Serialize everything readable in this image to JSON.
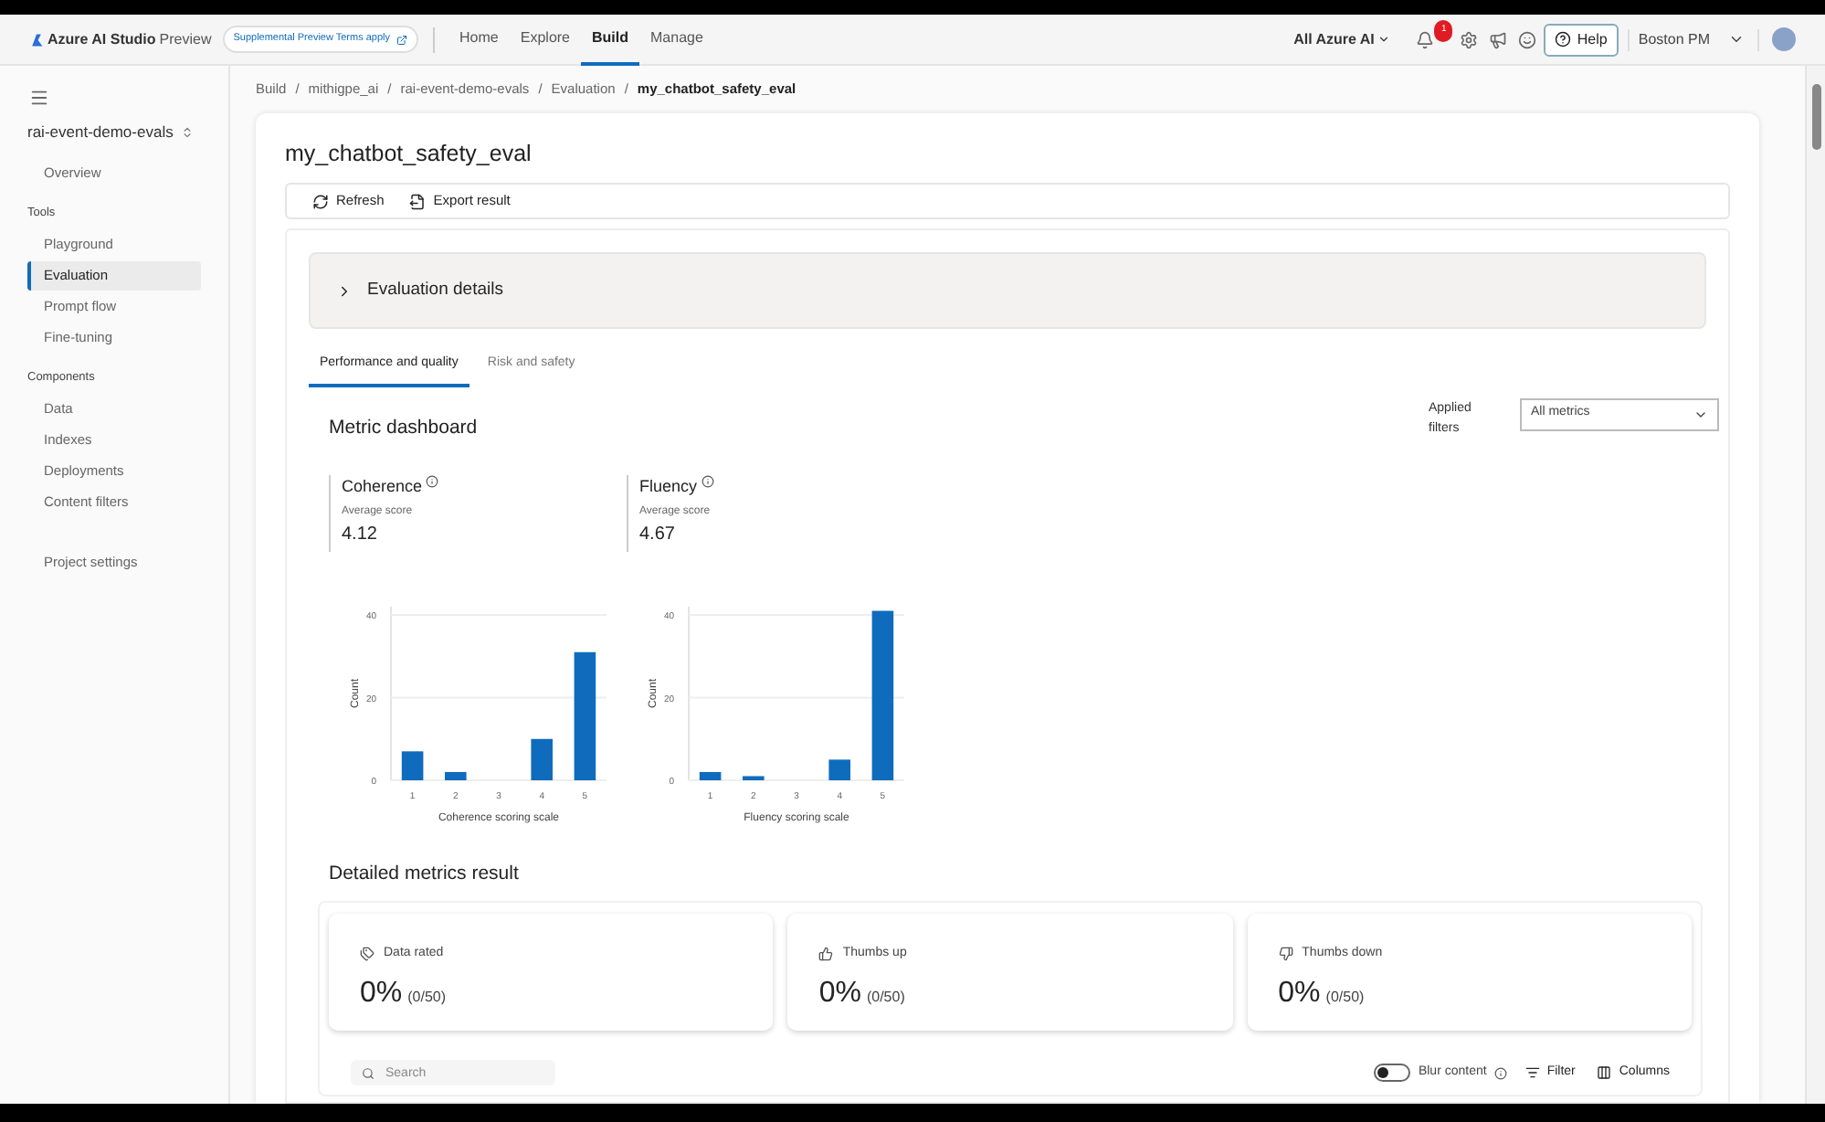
{
  "header": {
    "product": "Azure AI Studio",
    "preview": "Preview",
    "terms_badge": "Supplemental Preview Terms apply",
    "nav": [
      {
        "label": "Home",
        "selected": false
      },
      {
        "label": "Explore",
        "selected": false
      },
      {
        "label": "Build",
        "selected": true
      },
      {
        "label": "Manage",
        "selected": false
      }
    ],
    "scope": "All Azure AI",
    "notification_count": "1",
    "help": "Help",
    "user": "Boston PM"
  },
  "sidebar": {
    "project": "rai-event-demo-evals",
    "sections": [
      {
        "items": [
          {
            "label": "Overview",
            "selected": false
          }
        ]
      },
      {
        "heading": "Tools",
        "items": [
          {
            "label": "Playground",
            "selected": false
          },
          {
            "label": "Evaluation",
            "selected": true
          },
          {
            "label": "Prompt flow",
            "selected": false
          },
          {
            "label": "Fine-tuning",
            "selected": false
          }
        ]
      },
      {
        "heading": "Components",
        "items": [
          {
            "label": "Data",
            "selected": false
          },
          {
            "label": "Indexes",
            "selected": false
          },
          {
            "label": "Deployments",
            "selected": false
          },
          {
            "label": "Content filters",
            "selected": false
          }
        ]
      },
      {
        "items": [
          {
            "label": "Project settings",
            "selected": false
          }
        ]
      }
    ]
  },
  "breadcrumb_separator": "/",
  "breadcrumb": [
    "Build",
    "mithigpe_ai",
    "rai-event-demo-evals",
    "Evaluation",
    "my_chatbot_safety_eval"
  ],
  "page": {
    "title": "my_chatbot_safety_eval",
    "toolbar": [
      "Refresh",
      "Export result"
    ],
    "details": {
      "title": "Evaluation details",
      "expanded": false
    },
    "tabs": [
      {
        "label": "Performance and quality",
        "selected": true
      },
      {
        "label": "Risk and safety",
        "selected": false
      }
    ],
    "dashboard": {
      "title": "Metric dashboard",
      "filter_label": "Applied filters",
      "filter_value": "All metrics",
      "metrics": [
        {
          "name": "Coherence",
          "score_label": "Average score",
          "score": "4.12",
          "chart_data": {
            "type": "bar",
            "xlabel": "Coherence scoring scale",
            "ylabel": "Count",
            "categories": [
              "1",
              "2",
              "3",
              "4",
              "5"
            ],
            "series": [
              {
                "color": "#0f6cbd",
                "values": [
                  7,
                  2,
                  0,
                  10,
                  31
                ]
              }
            ],
            "ylim": [
              0,
              42
            ],
            "yticks": [
              0,
              20,
              40
            ]
          }
        },
        {
          "name": "Fluency",
          "score_label": "Average score",
          "score": "4.67",
          "chart_data": {
            "type": "bar",
            "xlabel": "Fluency scoring scale",
            "ylabel": "Count",
            "categories": [
              "1",
              "2",
              "3",
              "4",
              "5"
            ],
            "series": [
              {
                "color": "#0f6cbd",
                "values": [
                  2,
                  1,
                  0,
                  5,
                  41
                ]
              }
            ],
            "ylim": [
              0,
              42
            ],
            "yticks": [
              0,
              20,
              40
            ]
          }
        }
      ]
    },
    "detailed": {
      "title": "Detailed metrics result",
      "cards": [
        {
          "kind": "rated",
          "label": "Data rated",
          "percent": "0%",
          "fraction": "(0/50)"
        },
        {
          "kind": "up",
          "label": "Thumbs up",
          "percent": "0%",
          "fraction": "(0/50)"
        },
        {
          "kind": "down",
          "label": "Thumbs down",
          "percent": "0%",
          "fraction": "(0/50)"
        }
      ],
      "search_placeholder": "Search",
      "blur": {
        "label": "Blur content",
        "on": false
      },
      "filter": "Filter",
      "columns": "Columns"
    }
  }
}
